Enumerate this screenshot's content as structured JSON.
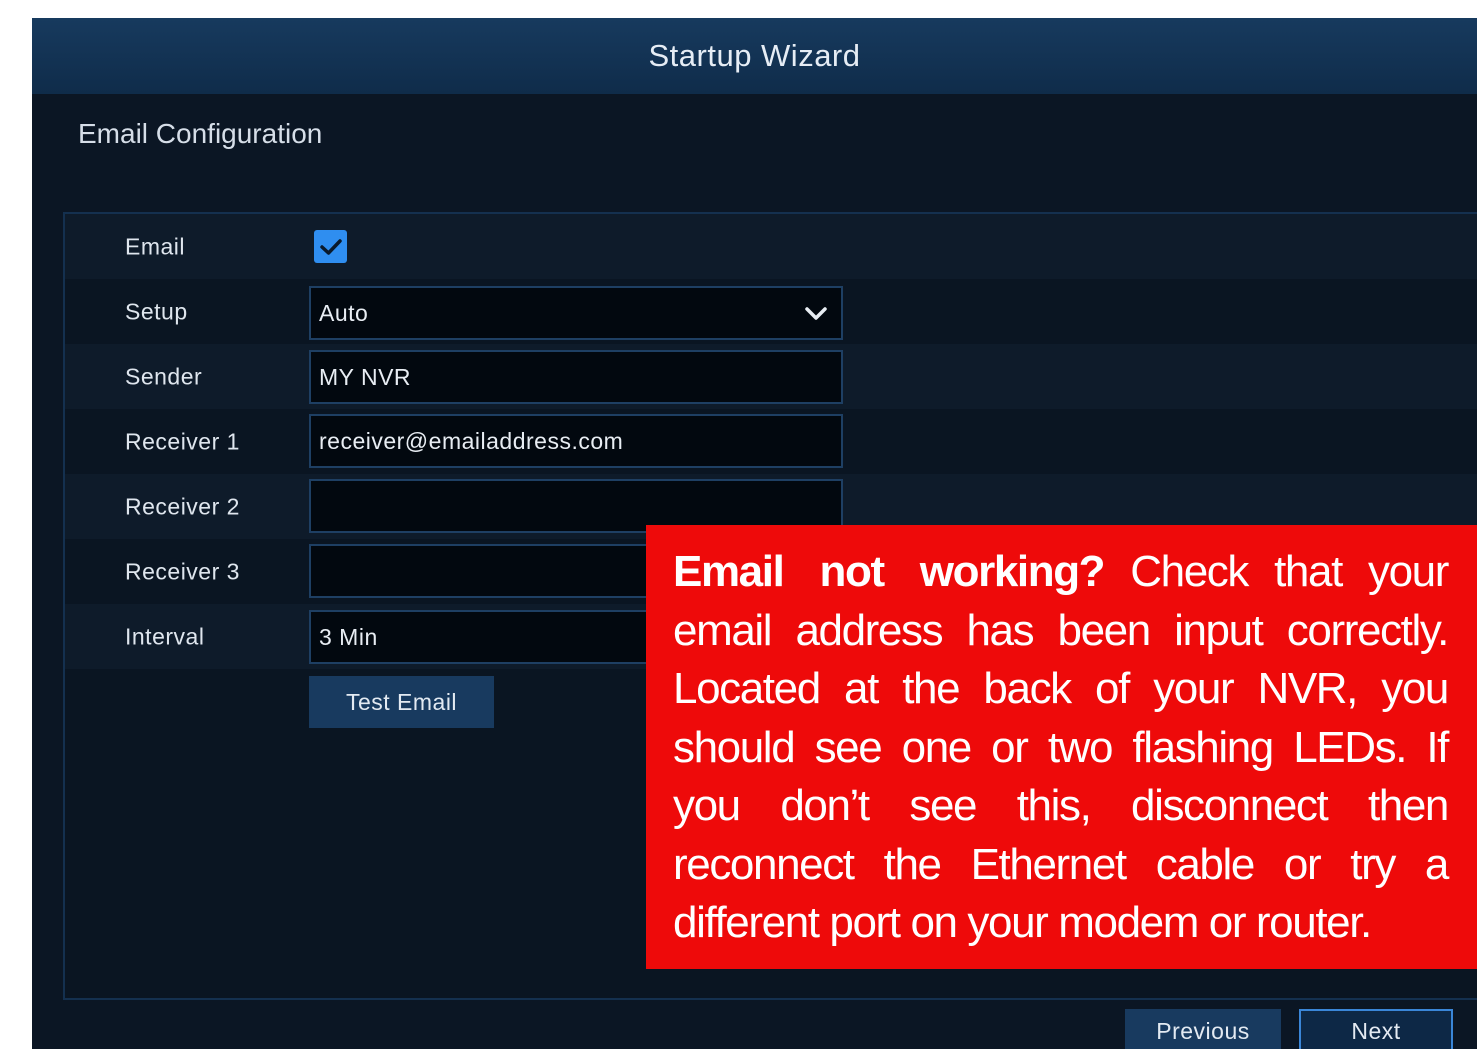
{
  "window": {
    "title": "Startup Wizard",
    "heading": "Email Configuration"
  },
  "form": {
    "email": {
      "label": "Email",
      "checked": true
    },
    "setup": {
      "label": "Setup",
      "value": "Auto"
    },
    "sender": {
      "label": "Sender",
      "value": "MY NVR"
    },
    "receiver1": {
      "label": "Receiver 1",
      "value": "receiver@emailaddress.com"
    },
    "receiver2": {
      "label": "Receiver 2",
      "value": ""
    },
    "receiver3": {
      "label": "Receiver 3",
      "value": ""
    },
    "interval": {
      "label": "Interval",
      "value": "3 Min"
    },
    "test_button": "Test Email"
  },
  "footer": {
    "previous": "Previous",
    "next": "Next"
  },
  "callout": {
    "headline": "Email not working?",
    "body": "Check that your email address has been input correctly. Located at the back of your NVR, you should see one or two flashing LEDs. If you don’t see this, disconnect then reconnect the Ethernet cable or try a different port on your modem or router."
  },
  "colors": {
    "titlebar": "#173a5e",
    "background": "#0b1624",
    "accent": "#2f8ef0",
    "callout": "#ee0a0a"
  },
  "icons": {
    "checkbox": "check-icon",
    "dropdown": "chevron-down-icon"
  }
}
